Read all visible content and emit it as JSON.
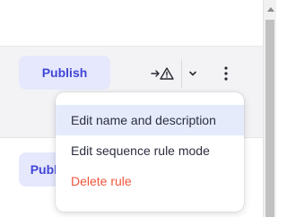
{
  "toolbar": {
    "publish_label": "Publish",
    "second_publish_label": "Publish",
    "warning_icon": "arrow-warning-icon",
    "chevron_icon": "chevron-down-icon",
    "more_icon": "vertical-ellipsis-icon"
  },
  "menu": {
    "items": [
      {
        "label": "Edit name and description",
        "state": "hovered"
      },
      {
        "label": "Edit sequence rule mode"
      },
      {
        "label": "Delete rule",
        "style": "danger"
      }
    ]
  },
  "colors": {
    "publish_bg": "#e6e8fd",
    "publish_text": "#4046d6",
    "menu_highlight": "#e6ebfc",
    "danger": "#f0563c",
    "row_bg": "#f3f3f5"
  }
}
